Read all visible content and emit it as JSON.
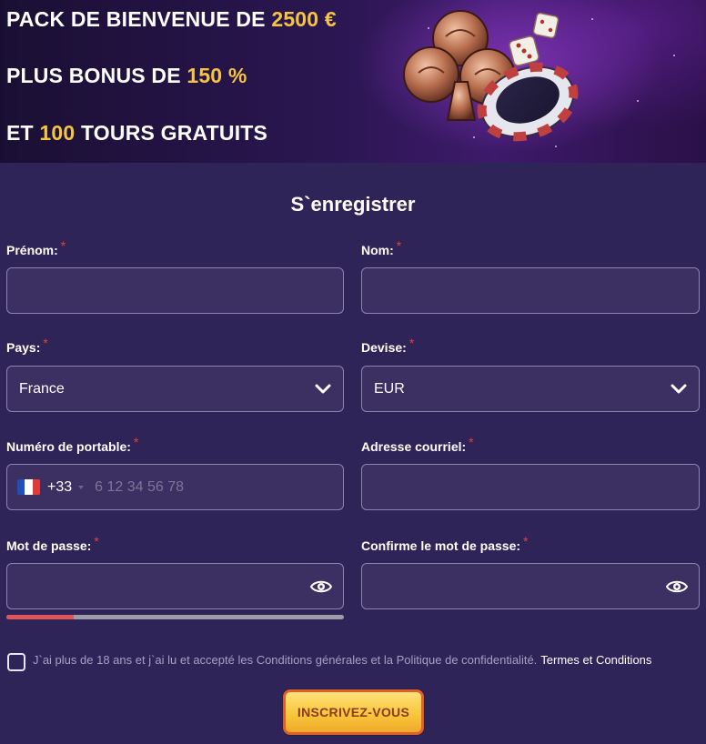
{
  "banner": {
    "line1_prefix": "PACK DE BIENVENUE DE ",
    "line1_highlight": "2500 €",
    "line2_prefix": "PLUS BONUS DE ",
    "line2_highlight": "150 %",
    "line3_prefix": "ET ",
    "line3_highlight": "100",
    "line3_suffix": " TOURS GRATUITS",
    "art_icons": [
      "club-suit-icon",
      "dice-icon",
      "casino-chip-icon"
    ],
    "highlight_color": "#f5c542"
  },
  "form": {
    "title": "S`enregistrer",
    "required_mark": "*",
    "first_name": {
      "label": "Prénom:",
      "value": ""
    },
    "last_name": {
      "label": "Nom:",
      "value": ""
    },
    "country": {
      "label": "Pays:",
      "selected": "France"
    },
    "currency": {
      "label": "Devise:",
      "selected": "EUR"
    },
    "phone": {
      "label": "Numéro de portable:",
      "country_code": "+33",
      "flag": "france-flag-icon",
      "placeholder": "6 12 34 56 78"
    },
    "email": {
      "label": "Adresse courriel:",
      "value": ""
    },
    "password": {
      "label": "Mot de passe:",
      "value": "",
      "strength_fraction": 0.2
    },
    "confirm_password": {
      "label": "Confirme le mot de passe:",
      "value": ""
    },
    "terms": {
      "text": "J`ai plus de 18 ans et j`ai lu et accepté les Conditions générales et la Politique de confidentialité.",
      "link": "Termes et Conditions",
      "checked": false
    },
    "submit_label": "INSCRIVEZ-VOUS"
  },
  "colors": {
    "background": "#2f2458",
    "input_background": "#3c3063",
    "required": "#e0423c",
    "strength_fill": "#e05558",
    "button": "#f8c73b"
  }
}
